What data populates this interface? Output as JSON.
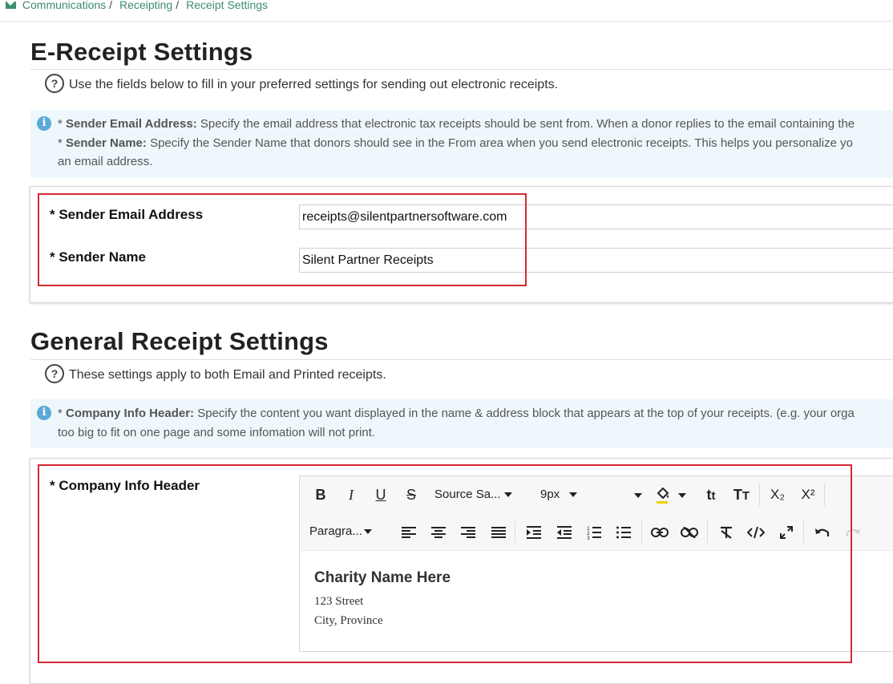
{
  "breadcrumb": {
    "icon": "envelope-icon",
    "items": [
      "Communications",
      "Receipting",
      "Receipt Settings"
    ],
    "separator": "/"
  },
  "ereceipt": {
    "title": "E-Receipt Settings",
    "help": "Use the fields below to fill in your preferred settings for sending out electronic receipts.",
    "info": {
      "line1_label": "Sender Email Address:",
      "line1_text": "Specify the email address that electronic tax receipts should be sent from. When a donor replies to the email containing the",
      "line2_label": "Sender Name:",
      "line2_text": "Specify the Sender Name that donors should see in the From area when you send electronic receipts. This helps you personalize yo",
      "line3_text": "an email address."
    },
    "fields": {
      "email_label": "* Sender Email Address",
      "email_value": "receipts@silentpartnersoftware.com",
      "name_label": "* Sender Name",
      "name_value": "Silent Partner Receipts"
    }
  },
  "general": {
    "title": "General Receipt Settings",
    "help": "These settings apply to both Email and Printed receipts.",
    "info": {
      "line1_label": "Company Info Header:",
      "line1_text": "Specify the content you want displayed in the name & address block that appears at the top of your receipts. (e.g. your orga",
      "line2_text": "too big to fit on one page and some infomation will not print."
    },
    "header_field": {
      "label": "* Company Info Header",
      "toolbar": {
        "font_family": "Source Sa...",
        "font_size": "9px",
        "paragraph": "Paragra...",
        "subscript": "X₂",
        "superscript": "X²"
      },
      "content": {
        "heading": "Charity Name Here",
        "line1": "123 Street",
        "line2": "City, Province"
      }
    }
  },
  "colors": {
    "accent_green": "#3d8d6b",
    "highlight_red": "#d42a35",
    "info_bg": "#eef7fb",
    "info_icon": "#5ba9d6"
  }
}
